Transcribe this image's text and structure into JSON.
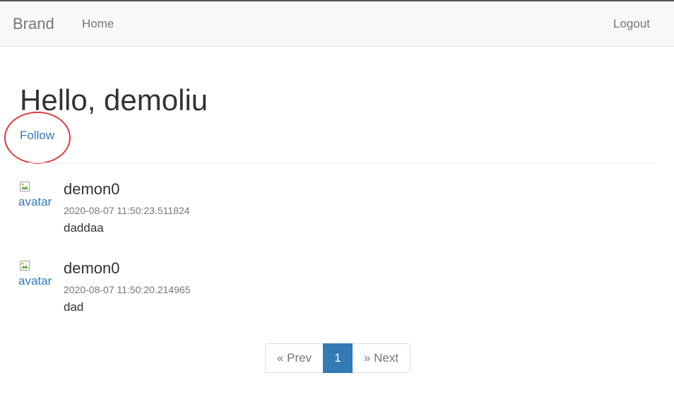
{
  "navbar": {
    "brand": "Brand",
    "home": "Home",
    "logout": "Logout"
  },
  "main": {
    "title": "Hello, demoliu",
    "follow": "Follow"
  },
  "posts": [
    {
      "avatar_alt": "avatar",
      "author": "demon0",
      "timestamp": "2020-08-07 11:50:23.511824",
      "body": "daddaa"
    },
    {
      "avatar_alt": "avatar",
      "author": "demon0",
      "timestamp": "2020-08-07 11:50:20.214965",
      "body": "dad"
    }
  ],
  "pagination": {
    "prev": "« Prev",
    "current": "1",
    "next": "» Next"
  },
  "colors": {
    "link": "#337ab7",
    "active_page": "#337ab7",
    "annotation": "#e0393e",
    "navbar_bg": "#f8f8f8"
  },
  "icons": {
    "avatar": "broken-image-icon"
  }
}
